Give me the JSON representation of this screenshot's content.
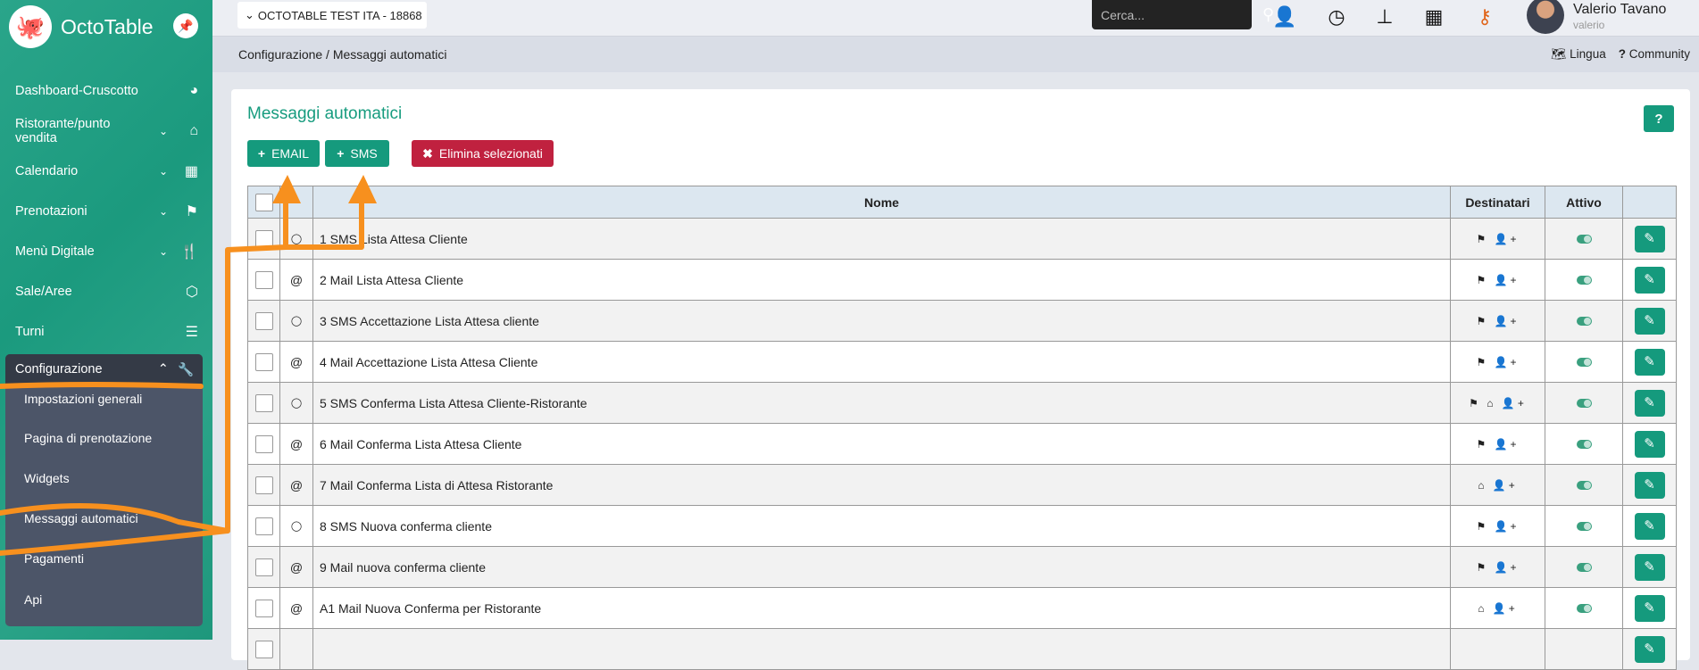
{
  "sidebar": {
    "brand": "OctoTable",
    "items": [
      {
        "label": "Dashboard-Cruscotto",
        "icon": "dashboard-icon",
        "glyph": "◕",
        "chevron": ""
      },
      {
        "label": "Ristorante/punto vendita",
        "icon": "home-icon",
        "glyph": "⌂",
        "chevron": "⌄"
      },
      {
        "label": "Calendario",
        "icon": "calendar-icon",
        "glyph": "▦",
        "chevron": "⌄"
      },
      {
        "label": "Prenotazioni",
        "icon": "flag-checkered-icon",
        "glyph": "⚑",
        "chevron": "⌄"
      },
      {
        "label": "Menù Digitale",
        "icon": "cutlery-icon",
        "glyph": "🍴",
        "chevron": "⌄"
      },
      {
        "label": "Sale/Aree",
        "icon": "codepen-icon",
        "glyph": "⬡",
        "chevron": ""
      },
      {
        "label": "Turni",
        "icon": "list-icon",
        "glyph": "☰",
        "chevron": ""
      }
    ],
    "config": {
      "label": "Configurazione",
      "chevron": "⌃",
      "glyph": "🔧",
      "subitems": [
        "Impostazioni generali",
        "Pagina di prenotazione",
        "Widgets",
        "Messaggi automatici",
        "Pagamenti",
        "Api"
      ]
    }
  },
  "topbar": {
    "org": "OCTOTABLE TEST ITA - 18868",
    "search_placeholder": "Cerca...",
    "user_name": "Valerio Tavano",
    "user_login": "valerio",
    "key_icon_color": "#e0651b"
  },
  "breadcrumb": "Configurazione / Messaggi automatici",
  "links": {
    "lingua": "Lingua",
    "community": "Community"
  },
  "page": {
    "title": "Messaggi automatici",
    "email_btn": "EMAIL",
    "sms_btn": "SMS",
    "delete_btn": "Elimina selezionati",
    "help": "?"
  },
  "table": {
    "headers": {
      "name": "Nome",
      "recipients": "Destinatari",
      "active": "Attivo"
    },
    "rows": [
      {
        "type": "sms",
        "name": "1 SMS Lista Attesa Cliente",
        "recipients": [
          "flag",
          "user-plus"
        ],
        "active": true
      },
      {
        "type": "mail",
        "name": "2 Mail Lista Attesa Cliente",
        "recipients": [
          "flag",
          "user-plus"
        ],
        "active": true
      },
      {
        "type": "sms",
        "name": "3 SMS Accettazione Lista Attesa cliente",
        "recipients": [
          "flag",
          "user-plus"
        ],
        "active": true
      },
      {
        "type": "mail",
        "name": "4 Mail Accettazione Lista Attesa Cliente",
        "recipients": [
          "flag",
          "user-plus"
        ],
        "active": true
      },
      {
        "type": "sms",
        "name": "5 SMS Conferma Lista Attesa Cliente-Ristorante",
        "recipients": [
          "flag",
          "home",
          "user-plus"
        ],
        "active": true
      },
      {
        "type": "mail",
        "name": "6 Mail Conferma Lista Attesa Cliente",
        "recipients": [
          "flag",
          "user-plus"
        ],
        "active": true
      },
      {
        "type": "mail",
        "name": "7 Mail Conferma Lista di Attesa Ristorante",
        "recipients": [
          "home",
          "user-plus"
        ],
        "active": true
      },
      {
        "type": "sms",
        "name": "8 SMS Nuova conferma cliente",
        "recipients": [
          "flag",
          "user-plus"
        ],
        "active": true
      },
      {
        "type": "mail",
        "name": "9 Mail nuova conferma cliente",
        "recipients": [
          "flag",
          "user-plus"
        ],
        "active": true
      },
      {
        "type": "mail",
        "name": "A1 Mail Nuova Conferma per Ristorante",
        "recipients": [
          "home",
          "user-plus"
        ],
        "active": true
      },
      {
        "type": "",
        "name": "",
        "recipients": [],
        "active": true
      }
    ]
  },
  "colors": {
    "brand": "#159a7d",
    "danger": "#c0213f",
    "annotation": "#f7901e"
  }
}
